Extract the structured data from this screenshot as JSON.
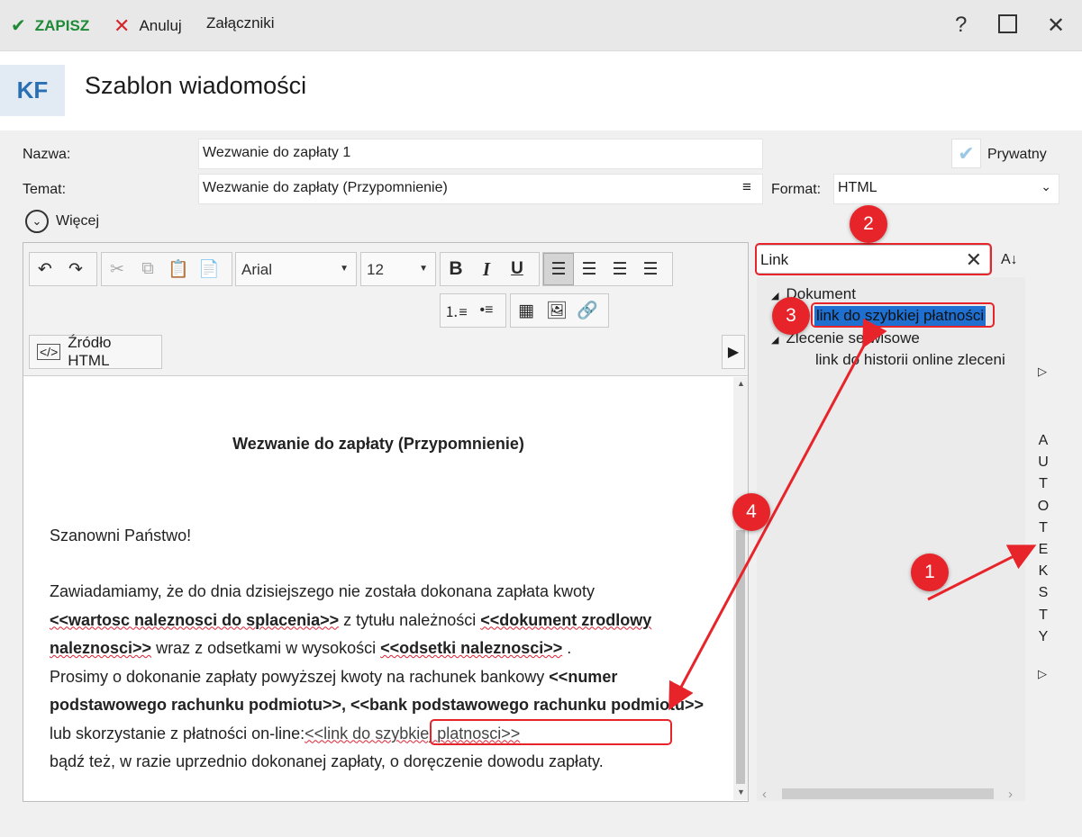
{
  "toolbar": {
    "save_label": "ZAPISZ",
    "cancel_label": "Anuluj",
    "attachments_label": "Załączniki",
    "help_label": "?"
  },
  "header": {
    "logo_text": "KF",
    "title": "Szablon wiadomości"
  },
  "form": {
    "name_label": "Nazwa:",
    "name_value": "Wezwanie do zapłaty 1",
    "subject_label": "Temat:",
    "subject_value": "Wezwanie do zapłaty (Przypomnienie)",
    "private_label": "Prywatny",
    "format_label": "Format:",
    "format_value": "HTML",
    "more_label": "Więcej"
  },
  "editor_toolbar": {
    "font_family": "Arial",
    "font_size": "12",
    "bold": "B",
    "italic": "I",
    "underline": "U",
    "source_html_label": "Źródło HTML"
  },
  "document": {
    "heading": "Wezwanie do zapłaty (Przypomnienie)",
    "greeting": "Szanowni Państwo!",
    "p1": "Zawiadamiamy, że do dnia dzisiejszego nie została dokonana zapłata kwoty",
    "f1": "<<wartosc naleznosci do splacenia>>",
    "p2": " z tytułu należności ",
    "f2": "<<dokument zrodlowy naleznosci>>",
    "p3": " wraz z odsetkami w wysokości ",
    "f3": "<<odsetki naleznosci>>",
    "p4": " .",
    "p5": "Prosimy o dokonanie zapłaty powyższej kwoty na rachunek bankowy ",
    "f4": "<<numer podstawowego rachunku podmiotu>>, <<bank podstawowego rachunku podmiotu>>",
    "p6": " lub skorzystanie z płatności on-line:",
    "f5": "<<link do szybkiej platnosci>>",
    "p7": "bądź też, w razie uprzednio dokonanej zapłaty, o doręczenie dowodu zapłaty."
  },
  "right_panel": {
    "search_value": "Link",
    "sort_label": "A↓",
    "tree": [
      {
        "label": "Dokument",
        "children": [
          "link do szybkiej płatności"
        ]
      },
      {
        "label": "Zlecenie serwisowe",
        "children": [
          "link do historii online zleceni"
        ]
      }
    ],
    "autotext_letters": [
      "A",
      "U",
      "T",
      "O",
      "T",
      "E",
      "K",
      "S",
      "T",
      "Y"
    ]
  },
  "annotations": {
    "badges": [
      "1",
      "2",
      "3",
      "4"
    ],
    "color": "#e8242b"
  },
  "colors": {
    "save_green": "#1f8a36",
    "cancel_red": "#d3252b",
    "selection_blue": "#1e6fd0",
    "logo_blue": "#2b6fb3"
  }
}
